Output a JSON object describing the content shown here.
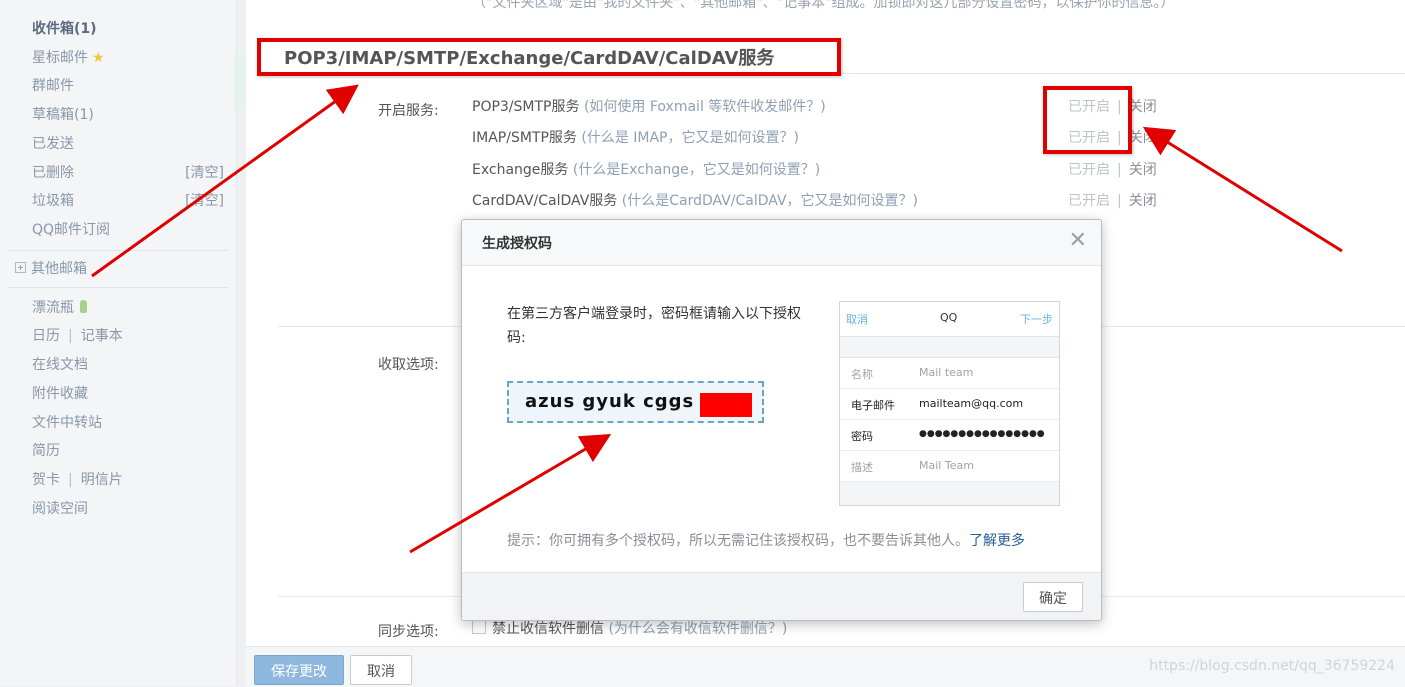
{
  "sidebar": {
    "inbox": "收件箱(1)",
    "starred": "星标邮件",
    "group": "群邮件",
    "drafts": "草稿箱(1)",
    "sent": "已发送",
    "deleted": "已删除",
    "deleted_clear": "[清空]",
    "spam": "垃圾箱",
    "spam_clear": "[清空]",
    "subscriptions": "QQ邮件订阅",
    "other_mailbox": "其他邮箱",
    "drift_bottle": "漂流瓶",
    "calendar": "日历",
    "notepad": "记事本",
    "online_docs": "在线文档",
    "attachments": "附件收藏",
    "file_transfer": "文件中转站",
    "resume": "简历",
    "greeting_card": "贺卡",
    "postcard": "明信片",
    "reading_space": "阅读空间"
  },
  "main": {
    "top_note": "（\"文件夹区域\"是由\"我的文件夹\"、\"其他邮箱\"、\"记事本\"组成。加锁即对这几部分设置密码，以保护你的信息。）",
    "section_title": "POP3/IMAP/SMTP/Exchange/CardDAV/CalDAV服务",
    "enable_service_label": "开启服务:",
    "services": [
      {
        "name": "POP3/SMTP服务",
        "help": "(如何使用 Foxmail 等软件收发邮件？)",
        "on": "已开启",
        "off": "关闭"
      },
      {
        "name": "IMAP/SMTP服务",
        "help": "(什么是 IMAP，它又是如何设置？)",
        "on": "已开启",
        "off": "关闭"
      },
      {
        "name": "Exchange服务",
        "help": "(什么是Exchange，它又是如何设置？)",
        "on": "已开启",
        "off": "关闭"
      },
      {
        "name": "CardDAV/CalDAV服务",
        "help": "(什么是CardDAV/CalDAV，它又是如何设置？)",
        "on": "已开启",
        "off": "关闭"
      }
    ],
    "receive_label": "收取选项:",
    "sync_label": "同步选项:",
    "sync_checkbox": "禁止收信软件删信",
    "sync_help": "(为什么会有收信软件删信？)",
    "save_button": "保存更改",
    "cancel_button": "取消",
    "watermark": "https://blog.csdn.net/qq_36759224"
  },
  "dialog": {
    "title": "生成授权码",
    "close_glyph": "✕",
    "message": "在第三方客户端登录时，密码框请输入以下授权码:",
    "auth_code": "azus gyuk cggs",
    "tip": "提示：你可拥有多个授权码，所以无需记住该授权码，也不要告诉其他人。",
    "learn_more": "了解更多",
    "ok_button": "确定",
    "phone": {
      "cancel": "取消",
      "title": "QQ",
      "next": "下一步",
      "rows": [
        {
          "key": "名称",
          "value": "Mail team"
        },
        {
          "key": "电子邮件",
          "value": "mailteam@qq.com"
        },
        {
          "key": "密码",
          "value": "●●●●●●●●●●●●●●●●"
        },
        {
          "key": "描述",
          "value": "Mail Team"
        }
      ]
    }
  },
  "colors": {
    "annotation_red": "#e00000",
    "primary_button": "#8fb8de",
    "link": "#2a5c9a"
  }
}
